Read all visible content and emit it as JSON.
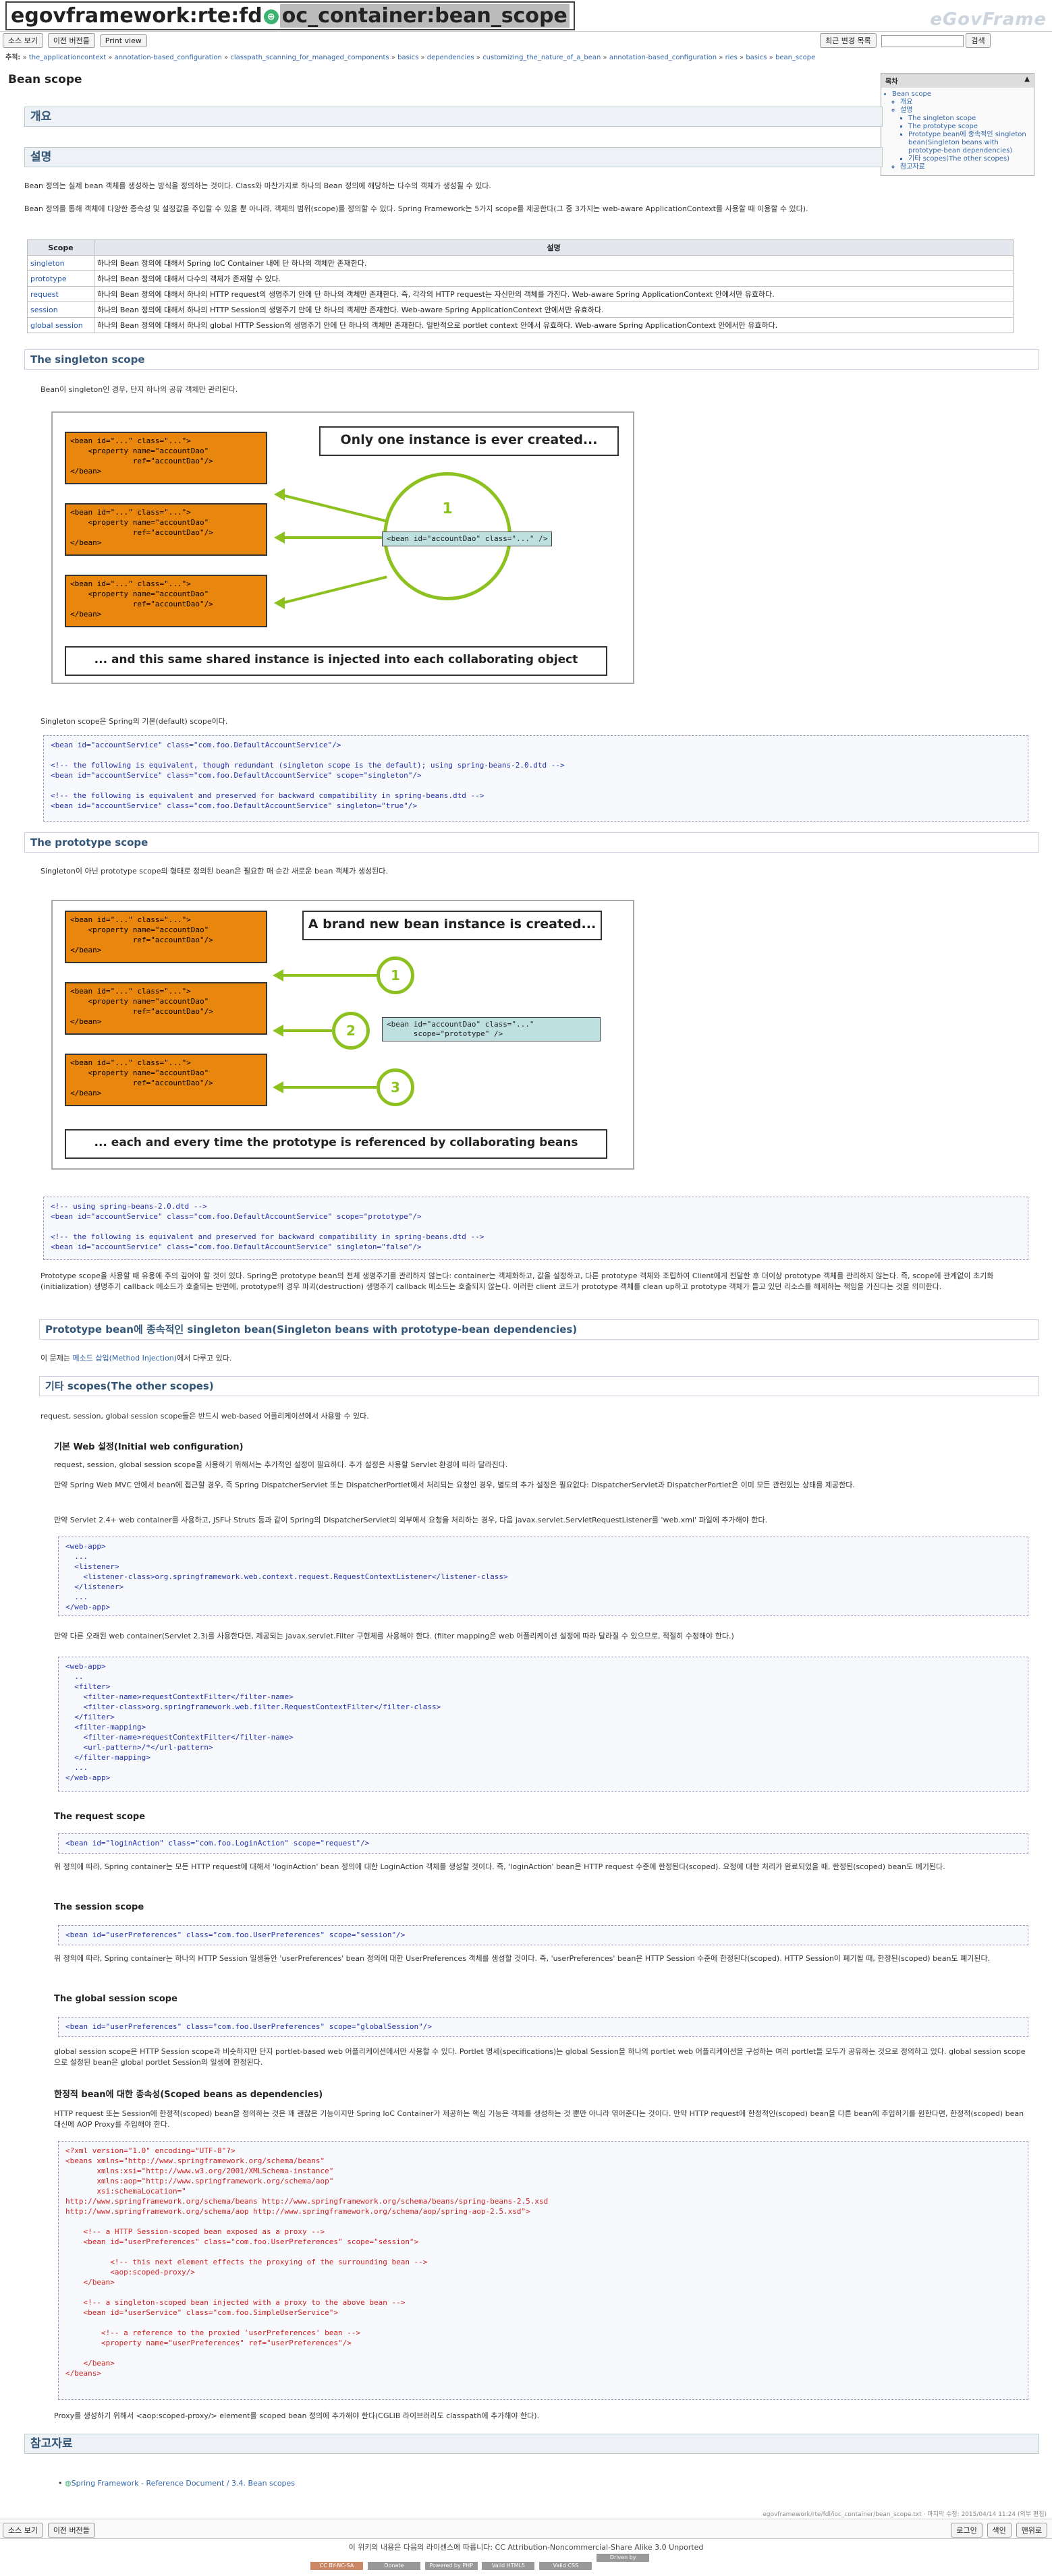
{
  "header": {
    "page_id_prefix": "egovframework:rte:fd",
    "page_id_suffix": "oc_container:bean_scope",
    "logo": "eGovFrame",
    "buttons": [
      "소스 보기",
      "이전 버전들",
      "Print view"
    ],
    "recent_button": "최근 변경 목록",
    "search_button": "검색"
  },
  "breadcrumb": {
    "label": "추적:",
    "items": [
      "the_applicationcontext",
      "annotation-based_configuration",
      "classpath_scanning_for_managed_components",
      "basics",
      "dependencies",
      "customizing_the_nature_of_a_bean",
      "annotation-based_configuration",
      "ries",
      "basics",
      "bean_scope"
    ]
  },
  "title": "Bean scope",
  "toc": {
    "label": "목차",
    "items": [
      "Bean scope",
      "개요",
      "설명",
      "The singleton scope",
      "The prototype scope",
      "Prototype bean에 종속적인 singleton bean(Singleton beans with prototype-bean dependencies)",
      "기타 scopes(The other scopes)",
      "참고자료"
    ]
  },
  "sections": {
    "overview": "개요",
    "description": "설명",
    "singleton": "The singleton scope",
    "prototype": "The prototype scope",
    "proto_dep": "Prototype bean에 종속적인 singleton bean(Singleton beans with prototype-bean dependencies)",
    "other": "기타 scopes(The other scopes)",
    "refs": "참고자료"
  },
  "texts": {
    "desc1": "Bean 정의는 실제 bean 객체를 생성하는 방식을 정의하는 것이다. Class와 마찬가지로 하나의 Bean 정의에 해당하는 다수의 객체가 생성될 수 있다.",
    "desc2": "Bean 정의를 통해 객체에 다양한 종속성 및 설정값을 주입할 수 있을 뿐 아니라, 객체의 범위(scope)를 정의할 수 있다. Spring Framework는 5가지 scope를 제공한다(그 중 3가지는 web-aware ApplicationContext를 사용할 때 이용할 수 있다).",
    "singleton_intro": "Bean이 singleton인 경우, 단지 하나의 공유 객체만 관리된다.",
    "singleton_default": "Singleton scope은 Spring의 기본(default) scope이다.",
    "prototype_intro": "Singleton이 아닌 prototype scope의 형태로 정의된 bean은 필요한 매 순간 새로운 bean 객체가 생성된다.",
    "prototype_desc": "Prototype scope을 사용할 때 유용에 주의 깊어야 할 것이 있다. Spring은 prototype bean의 전체 생명주기를 관리하지 않는다: container는 객체화하고, 값을 설정하고, 다른 prototype 객체와 조립하여 Client에게 전달한 후 더이상 prototype 객체를 관리하지 않는다. 즉, scope에 관계없이 초기화(initialization) 생명주기 callback 메소드가 호출되는 반면에, prototype의 경우 파괴(destruction) 생명주기 callback 메소드는 호출되지 않는다. 이러한 client 코드가 prototype 객체를 clean up하고 prototype 객체가 들고 있던 리소스를 해제하는 책임을 가진다는 것을 의미한다.",
    "proto_dep_text_a": "이 문제는 ",
    "proto_dep_link": "메소드 삽입(Method Injection)",
    "proto_dep_text_b": "에서 다루고 있다.",
    "other_intro": "request, session, global session scope들은 반드시 web-based 어플리케이션에서 사용할 수 있다.",
    "initial_web": "기본 Web 설정(Initial web configuration)",
    "initial_web_1": "request, session, global session scope을 사용하기 위해서는 추가적인 설정이 필요하다. 추가 설정은 사용할 Servlet 환경에 따라 달라진다.",
    "initial_web_2": "만약 Spring Web MVC 안에서 bean에 접근할 경우, 즉 Spring DispatcherServlet 또는 DispatcherPortlet에서 처리되는 요청인 경우, 별도의 추가 설정은 필요없다: DispatcherServlet과 DispatcherPortlet은 이미 모든 관련있는 상태를 제공한다.",
    "initial_web_3": "만약 Servlet 2.4+ web container를 사용하고, JSF나 Struts 등과 같이 Spring의 DispatcherServlet의 외부에서 요청을 처리하는 경우, 다음 javax.servlet.ServletRequestListener를 'web.xml' 파일에 추가해야 한다.",
    "initial_web_4": "만약 다른 오래된 web container(Servlet 2.3)를 사용한다면, 제공되는 javax.servlet.Filter 구현체를 사용해야 한다. (filter mapping은 web 어플리케이션 설정에 따라 달라질 수 있으므로, 적절히 수정해야 한다.)",
    "request_scope": "The request scope",
    "request_desc": "위 정의에 따라, Spring container는 모든 HTTP request에 대해서 'loginAction' bean 정의에 대한 LoginAction 객체를 생성할 것이다. 즉, 'loginAction' bean은 HTTP request 수준에 한정된다(scoped). 요청에 대한 처리가 완료되었을 때, 한정된(scoped) bean도 폐기된다.",
    "session_scope": "The session scope",
    "session_desc": "위 정의에 따라, Spring container는 하나의 HTTP Session 일생동안 'userPreferences' bean 정의에 대한 UserPreferences 객체를 생성할 것이다. 즉, 'userPreferences' bean은 HTTP Session 수준에 한정된다(scoped). HTTP Session이 폐기될 때, 한정된(scoped) bean도 폐기된다.",
    "global_scope": "The global session scope",
    "global_desc": "global session scope은 HTTP Session scope과 비슷하지만 단지 portlet-based web 어플리케이션에서만 사용할 수 있다. Portlet 명세(specifications)는 global Session을 하나의 portlet web 어플리케이션을 구성하는 여러 portlet들 모두가 공유하는 것으로 정의하고 있다. global session scope으로 설정된 bean은 global portlet Session의 일생에 한정된다.",
    "scoped_dep": "한정적 bean에 대한 종속성(Scoped beans as dependencies)",
    "scoped_dep_desc": "HTTP request 또는 Session에 한정적(scoped) bean을 정의하는 것은 꽤 괜찮은 기능이지만 Spring IoC Container가 제공하는 핵심 기능은 객체를 생성하는 것 뿐만 아니라 엮어준다는 것이다. 만약 HTTP request에 한정적인(scoped) bean을 다른 bean에 주입하기를 원한다면, 한정적(scoped) bean 대신에 AOP Proxy를 주입해야 한다.",
    "proxy_note": "Proxy를 생성하기 위해서 <aop:scoped-proxy/> element를 scoped bean 정의에 추가해야 한다(CGLIB 라이브러리도 classpath에 추가해야 한다).",
    "ref_item": "Spring Framework - Reference Document / 3.4. Bean scopes"
  },
  "scope_table": {
    "headers": [
      "Scope",
      "설명"
    ],
    "rows": [
      [
        "singleton",
        "하나의 Bean 정의에 대해서 Spring IoC Container 내에 단 하나의 객체만 존재한다."
      ],
      [
        "prototype",
        "하나의 Bean 정의에 대해서 다수의 객체가 존재할 수 있다."
      ],
      [
        "request",
        "하나의 Bean 정의에 대해서 하나의 HTTP request의 생명주기 안에 단 하나의 객체만 존재한다. 즉, 각각의 HTTP request는 자신만의 객체를 가진다. Web-aware Spring ApplicationContext 안에서만 유효하다."
      ],
      [
        "session",
        "하나의 Bean 정의에 대해서 하나의 HTTP Session의 생명주기 안에 단 하나의 객체만 존재한다. Web-aware Spring ApplicationContext 안에서만 유효하다."
      ],
      [
        "global session",
        "하나의 Bean 정의에 대해서 하나의 global HTTP Session의 생명주기 안에 단 하나의 객체만 존재한다. 일반적으로 portlet context 안에서 유효하다. Web-aware Spring ApplicationContext 안에서만 유효하다."
      ]
    ]
  },
  "diagrams": {
    "bean_line1": "<bean id=\"...\" class=\"...\">",
    "bean_line2": "    <property name=\"accountDao\"",
    "bean_line3": "              ref=\"accountDao\"/>",
    "bean_line4": "</bean>",
    "singleton_top": "Only one instance is ever created...",
    "singleton_bottom": "... and this same shared instance is injected into each collaborating object",
    "singleton_bean": "<bean id=\"accountDao\" class=\"...\" />",
    "singleton_num": "1",
    "proto_top": "A brand new bean instance is created...",
    "proto_bottom": "... each and every time the prototype is referenced by collaborating beans",
    "proto_bean1": "<bean id=\"accountDao\" class=\"...\"",
    "proto_bean2": "      scope=\"prototype\" />",
    "proto_nums": [
      "1",
      "2",
      "3"
    ]
  },
  "code": {
    "singleton": "<bean id=\"accountService\" class=\"com.foo.DefaultAccountService\"/>\n\n<!-- the following is equivalent, though redundant (singleton scope is the default); using spring-beans-2.0.dtd -->\n<bean id=\"accountService\" class=\"com.foo.DefaultAccountService\" scope=\"singleton\"/>\n\n<!-- the following is equivalent and preserved for backward compatibility in spring-beans.dtd -->\n<bean id=\"accountService\" class=\"com.foo.DefaultAccountService\" singleton=\"true\"/>",
    "prototype": "<!-- using spring-beans-2.0.dtd -->\n<bean id=\"accountService\" class=\"com.foo.DefaultAccountService\" scope=\"prototype\"/>\n\n<!-- the following is equivalent and preserved for backward compatibility in spring-beans.dtd -->\n<bean id=\"accountService\" class=\"com.foo.DefaultAccountService\" singleton=\"false\"/>",
    "listener": "<web-app>\n  ...\n  <listener>\n    <listener-class>org.springframework.web.context.request.RequestContextListener</listener-class>\n  </listener>\n  ...\n</web-app>",
    "filter": "<web-app>\n  ..\n  <filter>\n    <filter-name>requestContextFilter</filter-name>\n    <filter-class>org.springframework.web.filter.RequestContextFilter</filter-class>\n  </filter>\n  <filter-mapping>\n    <filter-name>requestContextFilter</filter-name>\n    <url-pattern>/*</url-pattern>\n  </filter-mapping>\n  ...\n</web-app>",
    "request": "<bean id=\"loginAction\" class=\"com.foo.LoginAction\" scope=\"request\"/>",
    "session": "<bean id=\"userPreferences\" class=\"com.foo.UserPreferences\" scope=\"session\"/>",
    "global": "<bean id=\"userPreferences\" class=\"com.foo.UserPreferences\" scope=\"globalSession\"/>",
    "aop": "<?xml version=\"1.0\" encoding=\"UTF-8\"?>\n<beans xmlns=\"http://www.springframework.org/schema/beans\"\n       xmlns:xsi=\"http://www.w3.org/2001/XMLSchema-instance\"\n       xmlns:aop=\"http://www.springframework.org/schema/aop\"\n       xsi:schemaLocation=\"\nhttp://www.springframework.org/schema/beans http://www.springframework.org/schema/beans/spring-beans-2.5.xsd\nhttp://www.springframework.org/schema/aop http://www.springframework.org/schema/aop/spring-aop-2.5.xsd\">\n\n    <!-- a HTTP Session-scoped bean exposed as a proxy -->\n    <bean id=\"userPreferences\" class=\"com.foo.UserPreferences\" scope=\"session\">\n\n          <!-- this next element effects the proxying of the surrounding bean -->\n          <aop:scoped-proxy/>\n    </bean>\n\n    <!-- a singleton-scoped bean injected with a proxy to the above bean -->\n    <bean id=\"userService\" class=\"com.foo.SimpleUserService\">\n\n        <!-- a reference to the proxied 'userPreferences' bean -->\n        <property name=\"userPreferences\" ref=\"userPreferences\"/>\n\n    </bean>\n</beans>"
  },
  "footer": {
    "meta": "egovframework/rte/fdl/ioc_container/bean_scope.txt · 마지막 수정: 2015/04/14 11:24 (외부 편집)",
    "left_buttons": [
      "소스 보기",
      "이전 버전들"
    ],
    "right_buttons": [
      "로그인",
      "색인",
      "맨위로"
    ],
    "license": "이 위키의 내용은 다음의 라이센스에 따릅니다: CC Attribution-Noncommercial-Share Alike 3.0 Unported",
    "badges": [
      "CC BY-NC-SA",
      "Donate",
      "Powered by PHP",
      "Valid HTML5",
      "Valid CSS",
      "Driven by DokuWiki"
    ]
  }
}
